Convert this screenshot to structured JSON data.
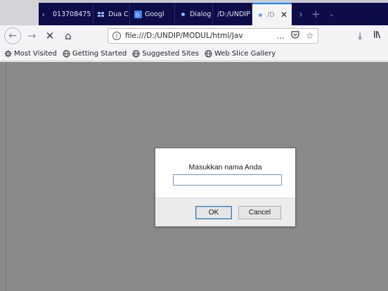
{
  "tabs": [
    {
      "label": "013708475",
      "icon": "page-icon"
    },
    {
      "label": "Dua C",
      "icon": "windows-store-icon"
    },
    {
      "label": "Googl",
      "icon": "google-translate-icon"
    },
    {
      "label": "Dialog",
      "icon": "dot-icon"
    },
    {
      "label": "/D:/UNDIP",
      "icon": "none"
    },
    {
      "label": "/D",
      "icon": "dot-icon",
      "active": true
    }
  ],
  "navbar": {
    "url": "file:///D:/UNDIP/MODUL/html/Jav",
    "page_actions_icon": "…",
    "back_icon": "←",
    "forward_icon": "→",
    "stop_icon": "✕",
    "home_icon": "⌂",
    "pocket_icon": "pocket-icon",
    "bookmark_icon": "☆",
    "download_icon": "⤓",
    "library_icon": "library-icon"
  },
  "bookmarks": [
    {
      "label": "Most Visited",
      "icon": "gear-icon"
    },
    {
      "label": "Getting Started",
      "icon": "globe-icon"
    },
    {
      "label": "Suggested Sites",
      "icon": "globe-icon"
    },
    {
      "label": "Web Slice Gallery",
      "icon": "globe-icon"
    }
  ],
  "dialog": {
    "message": "Masukkan nama Anda",
    "input_value": "",
    "ok_label": "OK",
    "cancel_label": "Cancel"
  },
  "colors": {
    "tabbar": "#0c0c49",
    "toolbar": "#f4f4f6",
    "content_overlay": "#8a8a8a",
    "accent": "#0a84ff"
  }
}
